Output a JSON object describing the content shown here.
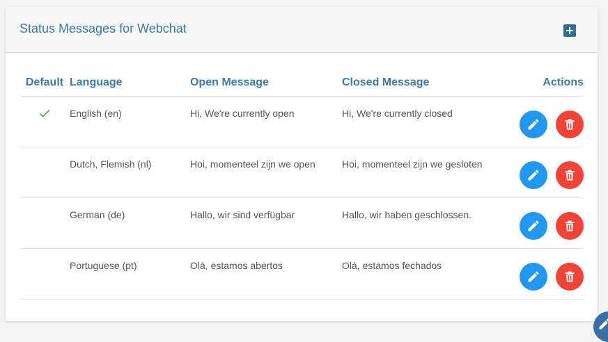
{
  "card": {
    "title": "Status Messages for Webchat"
  },
  "table": {
    "headers": {
      "default": "Default",
      "language": "Language",
      "open_message": "Open Message",
      "closed_message": "Closed Message",
      "actions": "Actions"
    },
    "rows": [
      {
        "is_default": true,
        "language": "English (en)",
        "open_message": "Hi, We're currently open",
        "closed_message": "Hi, We're currently closed"
      },
      {
        "is_default": false,
        "language": "Dutch, Flemish (nl)",
        "open_message": "Hoi, momenteel zijn we open",
        "closed_message": "Hoi, momenteel zijn we gesloten"
      },
      {
        "is_default": false,
        "language": "German (de)",
        "open_message": "Hallo, wir sind verfügbar",
        "closed_message": "Hallo, wir haben geschlossen."
      },
      {
        "is_default": false,
        "language": "Portuguese (pt)",
        "open_message": "Olá, estamos abertos",
        "closed_message": "Olá, estamos fechados"
      }
    ]
  },
  "icons": {
    "add": "plus-square-icon",
    "default": "check-icon",
    "edit": "pencil-icon",
    "delete": "trash-icon",
    "corner": "pencil-icon"
  },
  "colors": {
    "accent": "#3c7ca6",
    "edit_button": "#2196f3",
    "delete_button": "#f44336",
    "check": "#4caf50"
  }
}
